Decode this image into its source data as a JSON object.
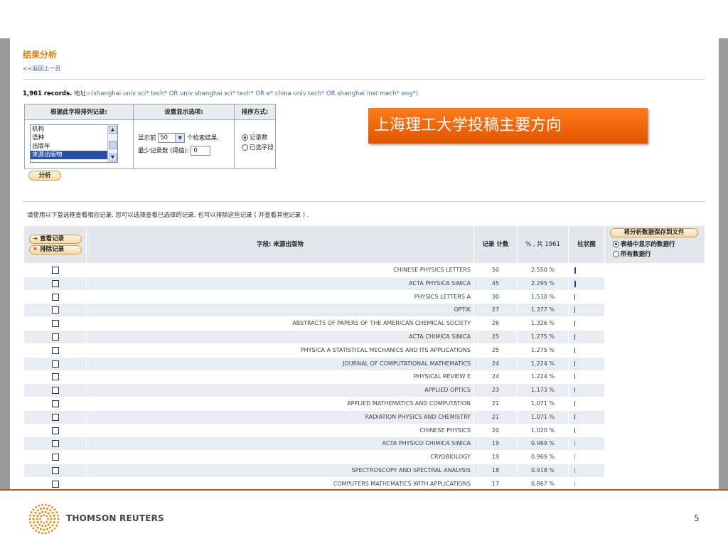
{
  "page": {
    "title": "结果分析",
    "back_link": "<<返回上一页",
    "records_count": "1,961 records.",
    "records_field": "地址",
    "records_query": "=(shanghai univ sci* tech* OR univ shanghai sci* tech* OR e* china univ tech* OR shanghai inst mech* eng*)",
    "instruction": "请使用以下复选框查看相应记录. 您可以选择查看已选择的记录, 也可以排除这些记录 ( 并查看其他记录 ) ."
  },
  "options": {
    "rank_header": "根据此字段排列记录:",
    "display_header": "设置显示选项:",
    "sort_header": "排序方式:",
    "fields": [
      "机构",
      "语种",
      "出版年",
      "来源出版物"
    ],
    "selected_field": "来源出版物",
    "show_top_prefix": "显示前",
    "show_top_value": "50",
    "show_top_suffix": "个检索结果.",
    "min_records_label": "最少记录数 (阈值):",
    "min_records_value": "0",
    "sort_by_count": "记录数",
    "sort_by_field": "已选字段",
    "analyze_button": "分析"
  },
  "overlay_label": "上海理工大学投稿主要方向",
  "results": {
    "view_button": "查看记录",
    "exclude_button": "排除记录",
    "field_header": "字段: 来源出版物",
    "count_header": "记录 计数",
    "percent_header": "% , 共 1961",
    "bar_header": "柱状图",
    "save_button": "将分析数据保存到文件",
    "save_option_table": "表格中显示的数据行",
    "save_option_all": "所有数据行",
    "rows": [
      {
        "name": "CHINESE PHYSICS LETTERS",
        "count": "50",
        "percent": "2.550 %",
        "fraction": 1.0
      },
      {
        "name": "ACTA PHYSICA SINICA",
        "count": "45",
        "percent": "2.295 %",
        "fraction": 0.9
      },
      {
        "name": "PHYSICS LETTERS A",
        "count": "30",
        "percent": "1.530 %",
        "fraction": 0.6
      },
      {
        "name": "OPTIK",
        "count": "27",
        "percent": "1.377 %",
        "fraction": 0.54
      },
      {
        "name": "ABSTRACTS OF PAPERS OF THE AMERICAN CHEMICAL SOCIETY",
        "count": "26",
        "percent": "1.326 %",
        "fraction": 0.52
      },
      {
        "name": "ACTA CHIMICA SINICA",
        "count": "25",
        "percent": "1.275 %",
        "fraction": 0.5
      },
      {
        "name": "PHYSICA A STATISTICAL MECHANICS AND ITS APPLICATIONS",
        "count": "25",
        "percent": "1.275 %",
        "fraction": 0.5
      },
      {
        "name": "JOURNAL OF COMPUTATIONAL MATHEMATICS",
        "count": "24",
        "percent": "1.224 %",
        "fraction": 0.48
      },
      {
        "name": "PHYSICAL REVIEW E",
        "count": "24",
        "percent": "1.224 %",
        "fraction": 0.48
      },
      {
        "name": "APPLIED OPTICS",
        "count": "23",
        "percent": "1.173 %",
        "fraction": 0.46
      },
      {
        "name": "APPLIED MATHEMATICS AND COMPUTATION",
        "count": "21",
        "percent": "1.071 %",
        "fraction": 0.42
      },
      {
        "name": "RADIATION PHYSICS AND CHEMISTRY",
        "count": "21",
        "percent": "1.071 %",
        "fraction": 0.42
      },
      {
        "name": "CHINESE PHYSICS",
        "count": "20",
        "percent": "1.020 %",
        "fraction": 0.4
      },
      {
        "name": "ACTA PHYSICO CHIMICA SINICA",
        "count": "19",
        "percent": "0.969 %",
        "fraction": 0.38
      },
      {
        "name": "CRYOBIOLOGY",
        "count": "19",
        "percent": "0.969 %",
        "fraction": 0.38
      },
      {
        "name": "SPECTROSCOPY AND SPECTRAL ANALYSIS",
        "count": "18",
        "percent": "0.918 %",
        "fraction": 0.36
      },
      {
        "name": "COMPUTERS MATHEMATICS WITH APPLICATIONS",
        "count": "17",
        "percent": "0.867 %",
        "fraction": 0.34
      }
    ]
  },
  "footer": {
    "brand": "THOMSON REUTERS",
    "page_number": "5",
    "logo_icon": "thomson-reuters-logo-icon"
  },
  "colors": {
    "accent_orange": "#e07b00",
    "overlay_orange": "#ff6a00",
    "bar_blue": "#1a4fa0",
    "row_alt": "#e7edf2"
  }
}
